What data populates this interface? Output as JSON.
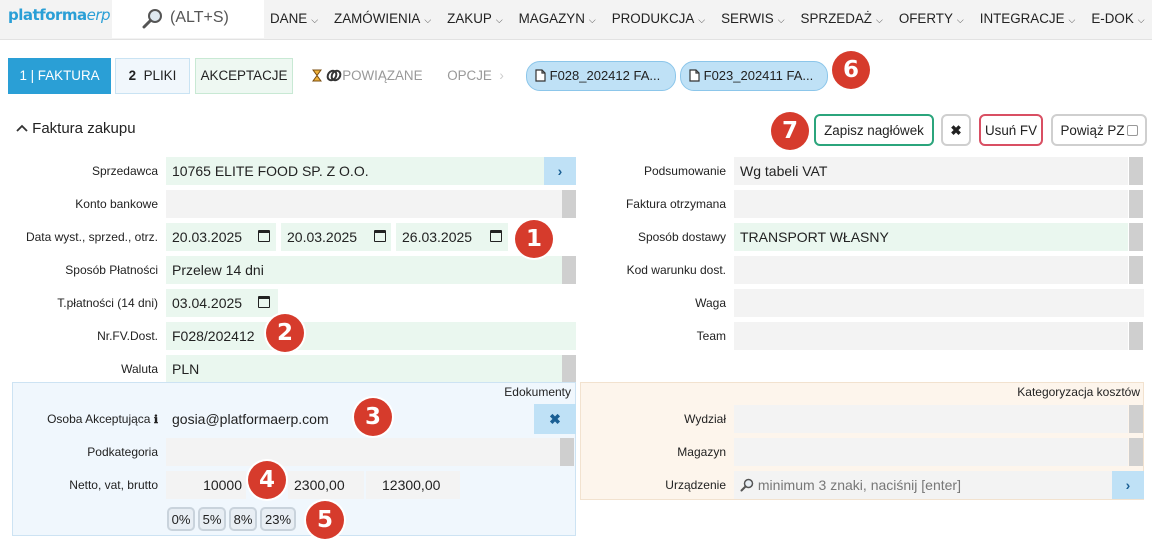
{
  "nav": {
    "logo_main": "platforma",
    "logo_erp": "erp",
    "search_label": "(ALT+S)",
    "menu": [
      "DANE",
      "ZAMÓWIENIA",
      "ZAKUP",
      "MAGAZYN",
      "PRODUKCJA",
      "SERWIS",
      "SPRZEDAŻ",
      "OFERTY",
      "INTEGRACJE",
      "E-DOK"
    ]
  },
  "tabs": {
    "faktura": "1 | FAKTURA",
    "pliki_num": "2",
    "pliki": "PLIKI",
    "akceptacje": "AKCEPTACJE",
    "powiazane": "POWIĄZANE",
    "opcje": "OPCJE",
    "chips": [
      "F028_202412 FA...",
      "F023_202411 FA..."
    ]
  },
  "header": {
    "title": "Faktura zakupu",
    "save": "Zapisz nagłówek",
    "close": "✖",
    "delete": "Usuń FV",
    "link": "Powiąż PZ"
  },
  "left_form": {
    "sprzedawca_label": "Sprzedawca",
    "sprzedawca": "10765 ELITE FOOD SP. Z O.O.",
    "konto_label": "Konto bankowe",
    "konto": "",
    "daty_label": "Data wyst., sprzed., otrz.",
    "data_wyst": "20.03.2025",
    "data_sprzed": "20.03.2025",
    "data_otrz": "26.03.2025",
    "platnosc_label": "Sposób Płatności",
    "platnosc": "Przelew 14 dni",
    "termin_label": "T.płatności (14 dni)",
    "termin": "03.04.2025",
    "nrfv_label": "Nr.FV.Dost.",
    "nrfv": "F028/202412",
    "waluta_label": "Waluta",
    "waluta": "PLN"
  },
  "right_form": {
    "podsumowanie_label": "Podsumowanie",
    "podsumowanie": "Wg tabeli VAT",
    "otrzymana_label": "Faktura otrzymana",
    "otrzymana": "",
    "dostawa_label": "Sposób dostawy",
    "dostawa": "TRANSPORT WŁASNY",
    "warunek_label": "Kod warunku dost.",
    "warunek": "",
    "waga_label": "Waga",
    "waga": "",
    "team_label": "Team",
    "team": ""
  },
  "edok": {
    "caption": "Edokumenty",
    "osoba_label": "Osoba Akceptująca",
    "osoba": "gosia@platformaerp.com",
    "podkat_label": "Podkategoria",
    "podkat": "",
    "kwoty_label": "Netto, vat, brutto",
    "netto": "10000",
    "vat": "2300,00",
    "brutto": "12300,00",
    "rates": [
      "0%",
      "5%",
      "8%",
      "23%"
    ]
  },
  "koszty": {
    "caption": "Kategoryzacja kosztów",
    "wydzial_label": "Wydział",
    "wydzial": "",
    "magazyn_label": "Magazyn",
    "magazyn": "",
    "urzadzenie_label": "Urządzenie",
    "urzadzenie_placeholder": "minimum 3 znaki, naciśnij [enter]"
  },
  "badges": [
    "1",
    "2",
    "3",
    "4",
    "5",
    "6",
    "7"
  ],
  "colors": {
    "accent": "#2a9fd6",
    "badge": "#d63b2c",
    "field_green": "#eaf7ef",
    "field_grey": "#f3f3f3",
    "chip": "#bfe1f6"
  }
}
